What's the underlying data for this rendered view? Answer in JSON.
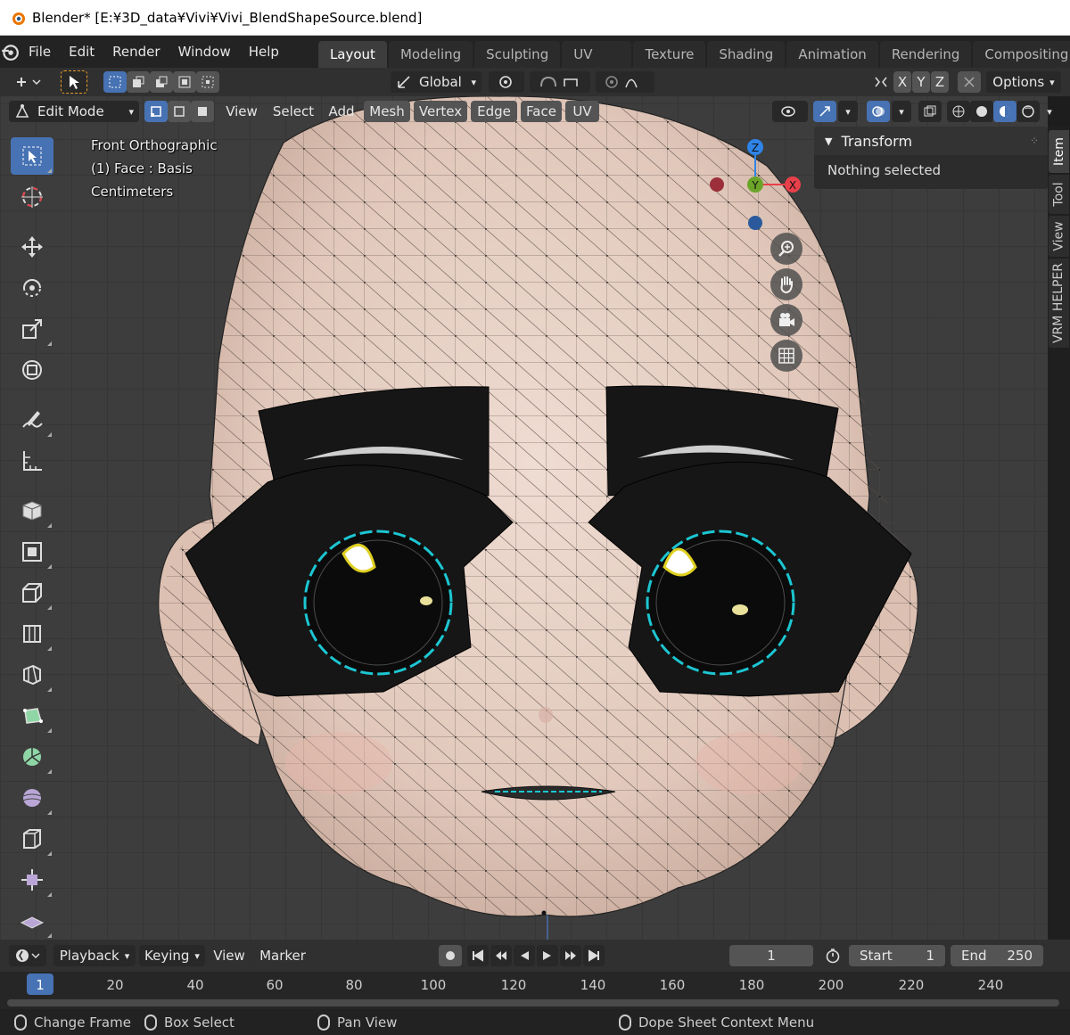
{
  "window": {
    "title": "Blender* [E:¥3D_data¥Vivi¥Vivi_BlendShapeSource.blend]"
  },
  "menu": {
    "items": [
      "File",
      "Edit",
      "Render",
      "Window",
      "Help"
    ]
  },
  "workspaces": {
    "active": "Layout",
    "tabs": [
      "Layout",
      "Modeling",
      "Sculpting",
      "UV Editing",
      "Texture Paint",
      "Shading",
      "Animation",
      "Rendering",
      "Compositing"
    ]
  },
  "tool_header": {
    "orientation": "Global",
    "axes": [
      "X",
      "Y",
      "Z"
    ],
    "options_label": "Options"
  },
  "view_header": {
    "mode": "Edit Mode",
    "menus": [
      "View",
      "Select",
      "Add",
      "Mesh",
      "Vertex",
      "Edge",
      "Face",
      "UV"
    ]
  },
  "viewport": {
    "view_name": "Front Orthographic",
    "object_info": "(1) Face : Basis",
    "units": "Centimeters",
    "gizmo": {
      "z": "Z",
      "y": "Y",
      "x": "X"
    }
  },
  "npanel": {
    "section_title": "Transform",
    "message": "Nothing selected",
    "tabs": [
      "Item",
      "Tool",
      "View",
      "VRM HELPER"
    ]
  },
  "timeline": {
    "menus": [
      "Playback",
      "Keying",
      "View",
      "Marker"
    ],
    "current_frame": "1",
    "start_label": "Start",
    "start_value": "1",
    "end_label": "End",
    "end_value": "250",
    "ruler": [
      "1",
      "20",
      "40",
      "60",
      "80",
      "100",
      "120",
      "140",
      "160",
      "180",
      "200",
      "220",
      "240"
    ]
  },
  "statusbar": {
    "items": [
      "Change Frame",
      "Box Select",
      "Pan View",
      "Dope Sheet Context Menu"
    ]
  },
  "colors": {
    "accent": "#4772b3",
    "axis_x": "#e8404a",
    "axis_y": "#6ca42a",
    "axis_z": "#2f84e8",
    "skin": "#e6cfc3",
    "eye_black": "#161616"
  }
}
